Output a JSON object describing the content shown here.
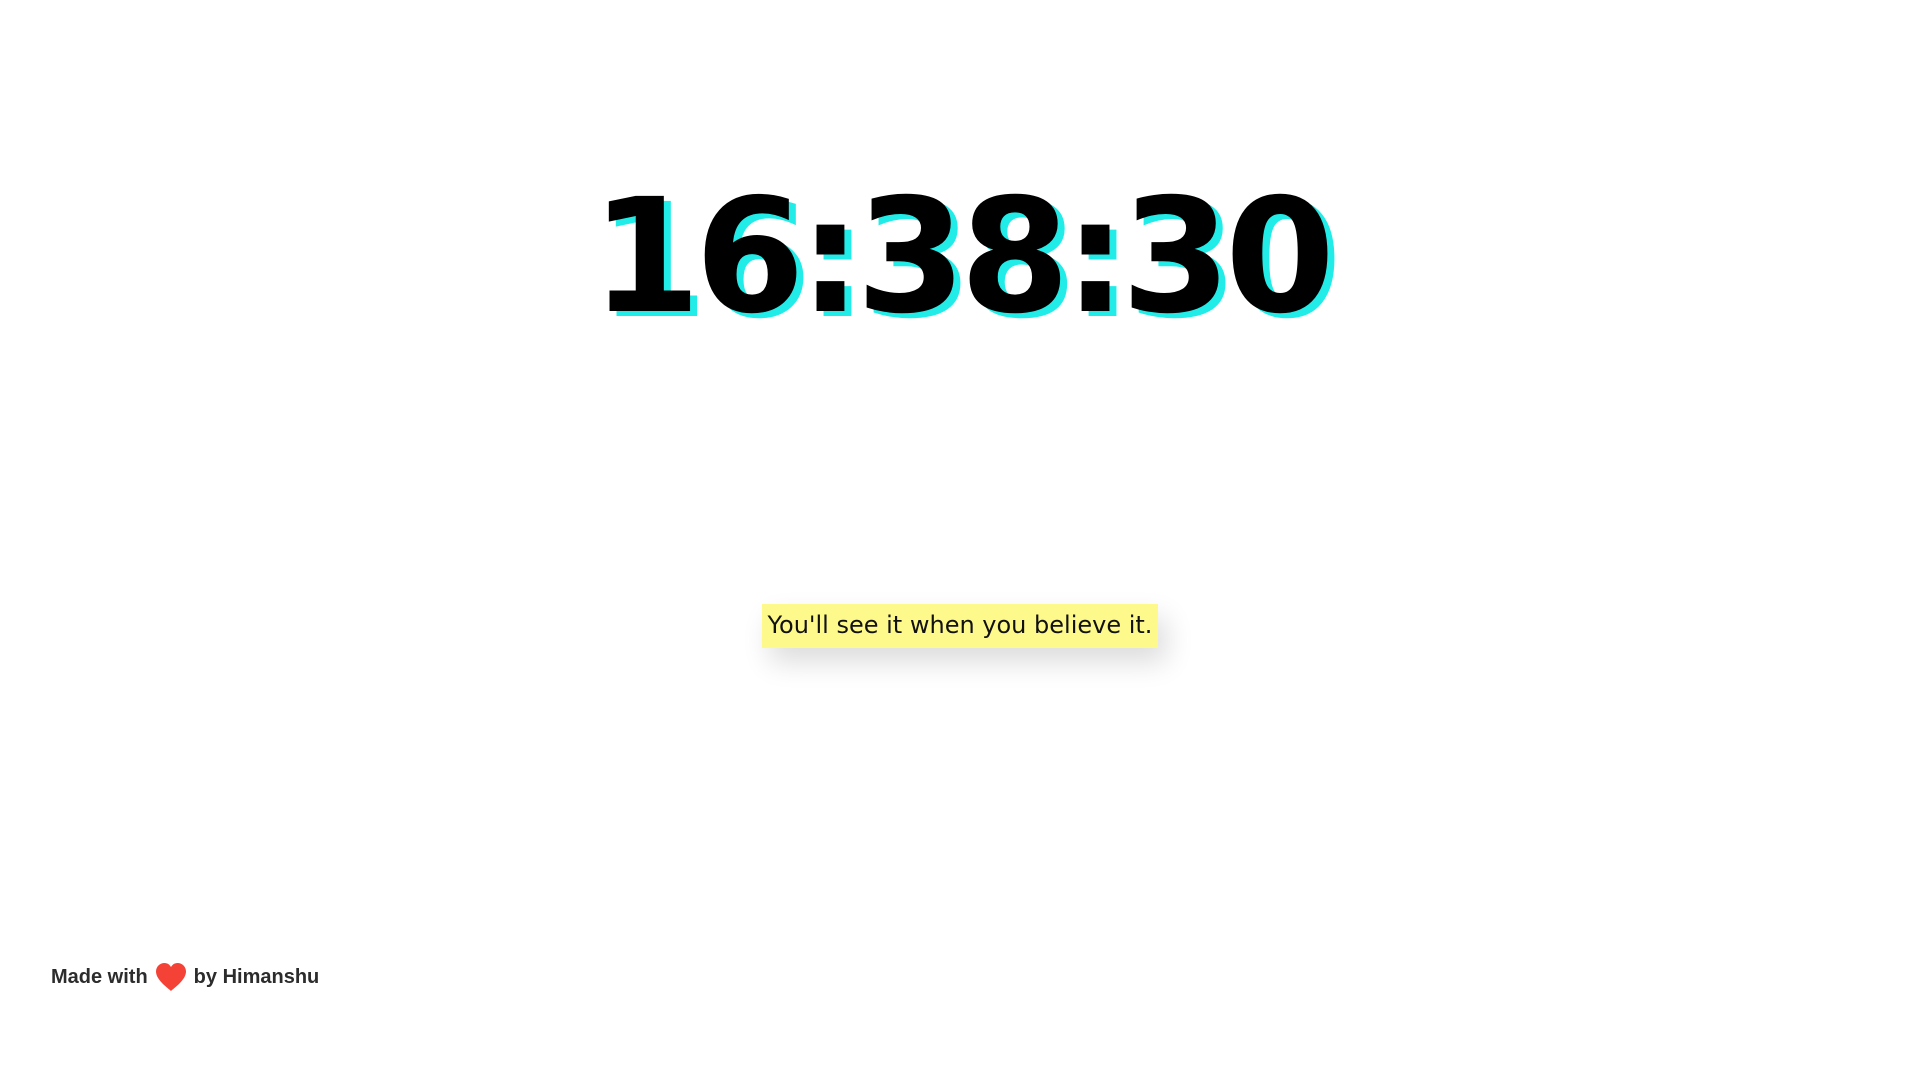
{
  "clock": {
    "time": "16:38:30"
  },
  "quote": {
    "text": "You'll see it when you believe it."
  },
  "footer": {
    "made_with": "Made with",
    "by": "by Himanshu",
    "heart_icon": "heart-icon",
    "heart_color": "#f44336"
  },
  "colors": {
    "clock_shadow": "#22ece7",
    "quote_background": "#fdf98a"
  }
}
